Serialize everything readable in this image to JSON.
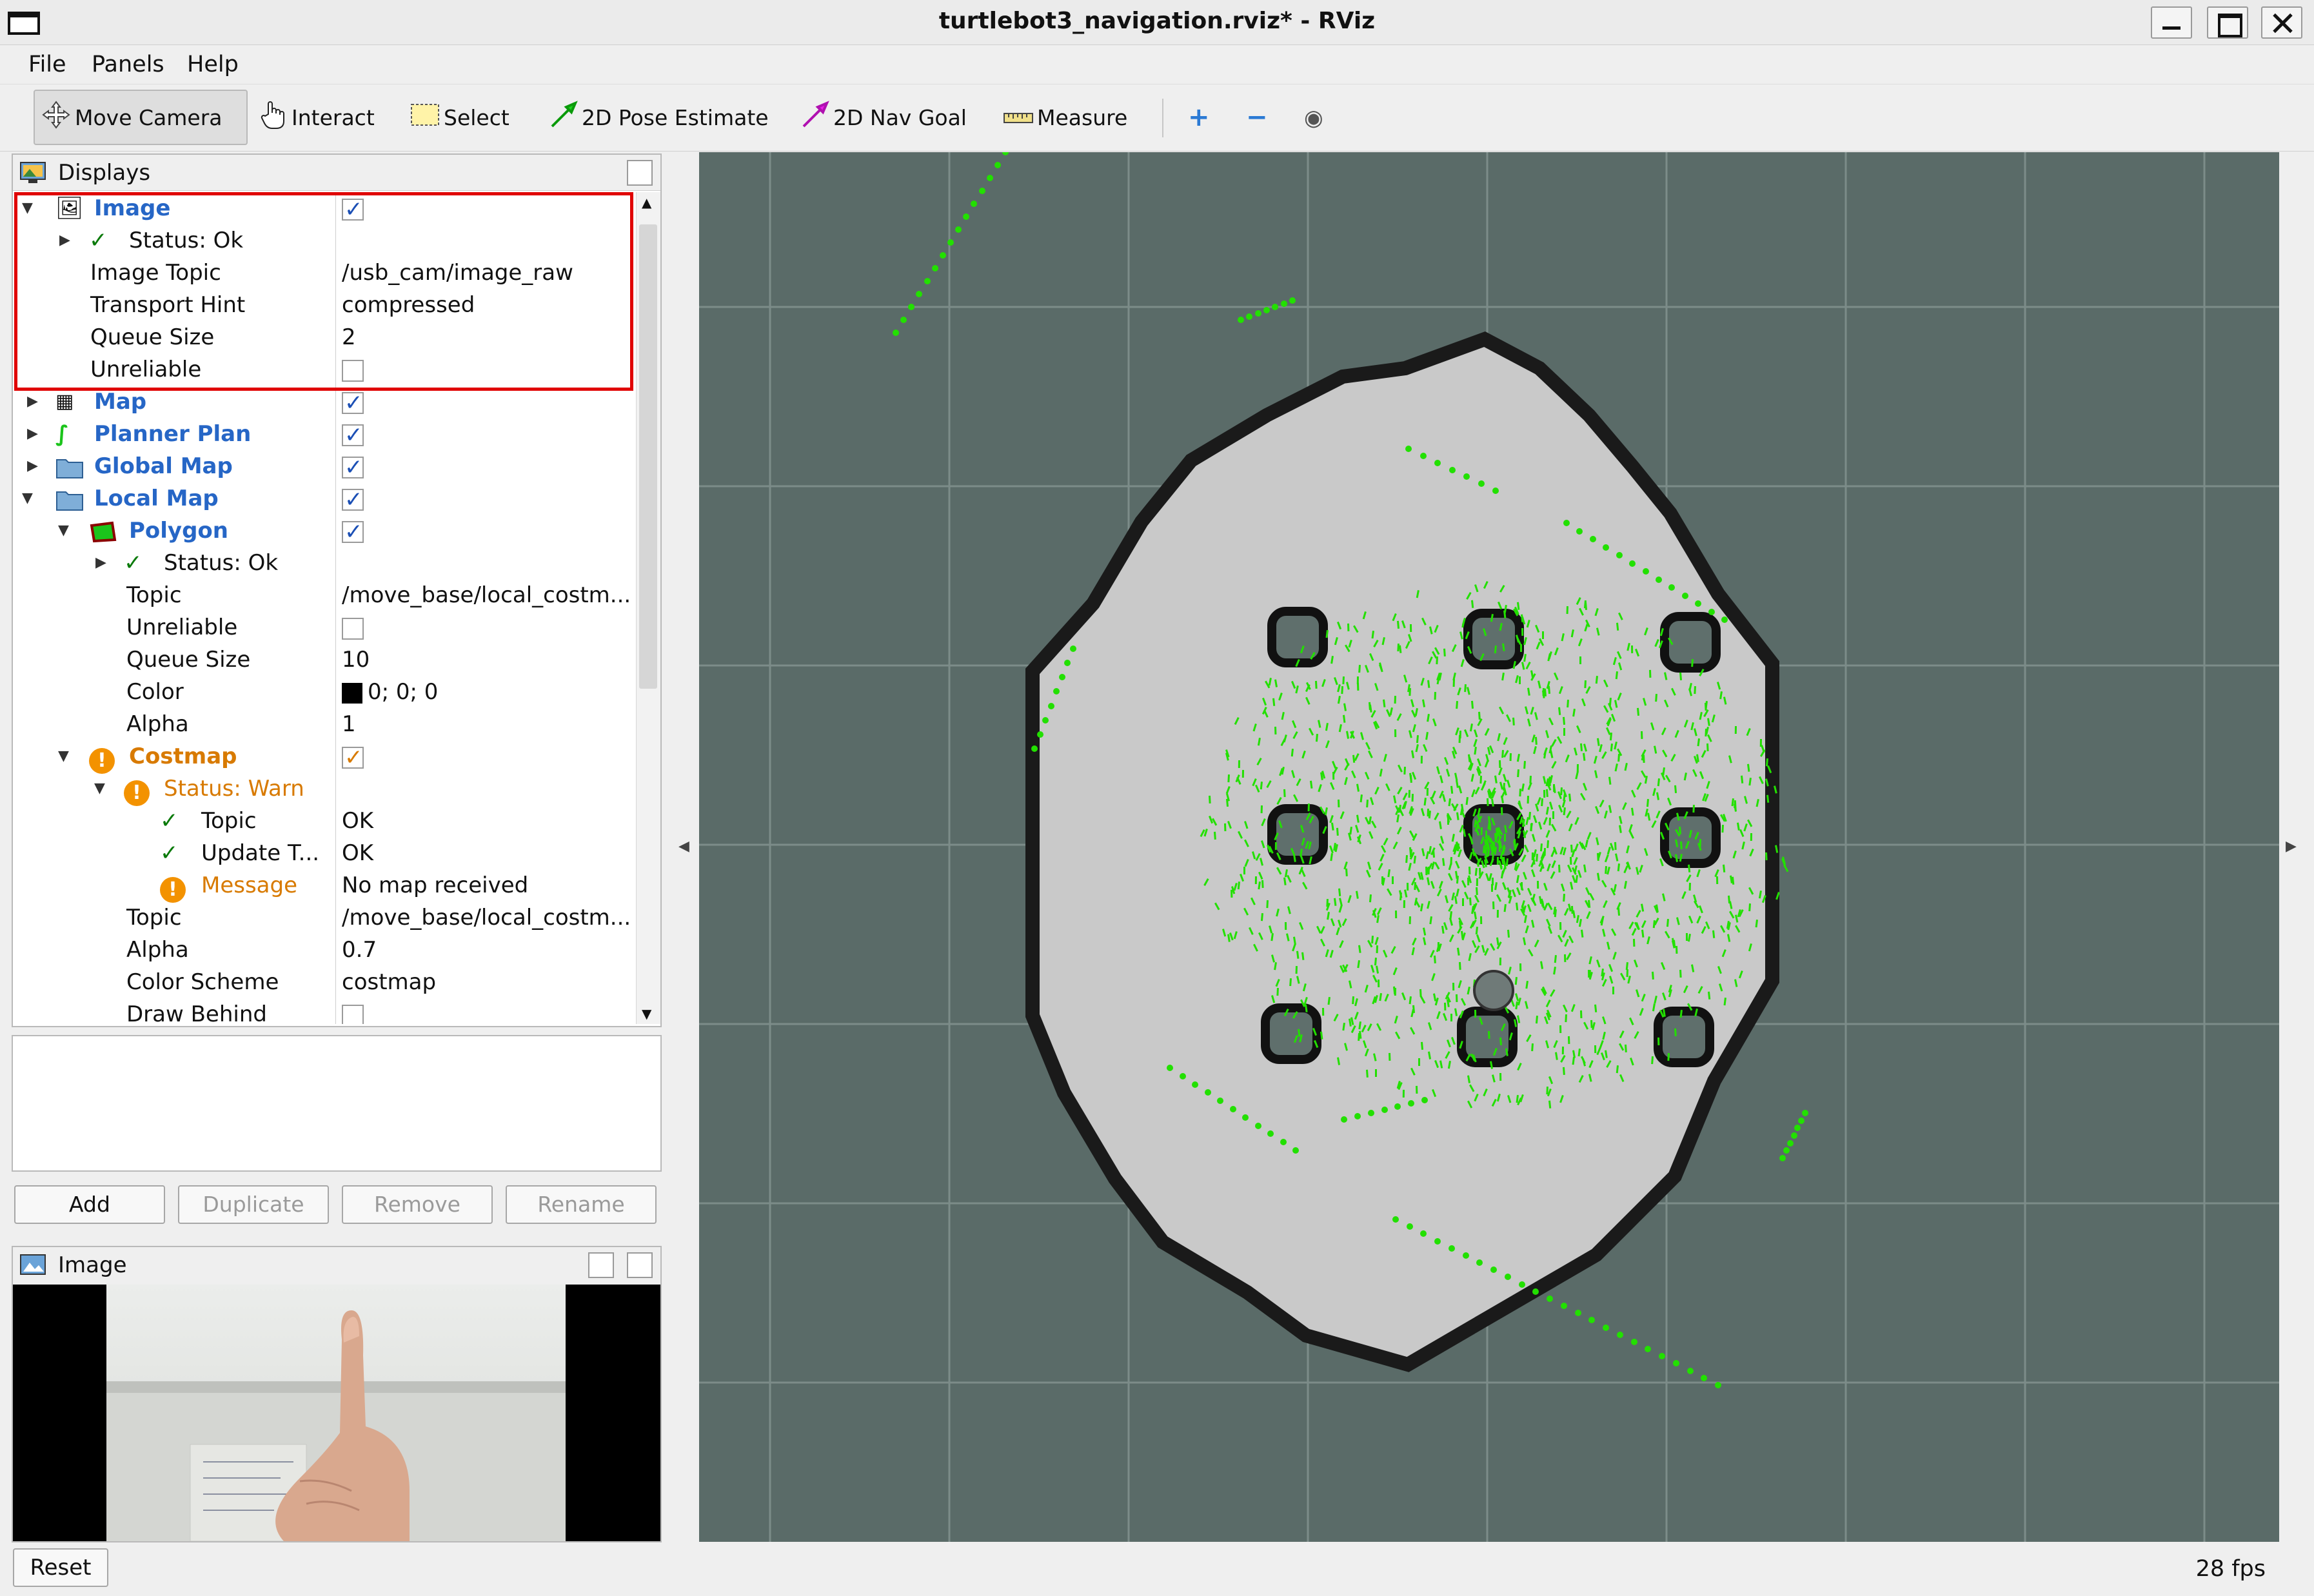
{
  "window": {
    "title": "turtlebot3_navigation.rviz* - RViz"
  },
  "menu": {
    "file": "File",
    "panels": "Panels",
    "help": "Help"
  },
  "toolbar": {
    "move_camera": "Move Camera",
    "interact": "Interact",
    "select": "Select",
    "pose_estimate": "2D Pose Estimate",
    "nav_goal": "2D Nav Goal",
    "measure": "Measure",
    "zoom_in_icon": "plus-icon",
    "zoom_out_icon": "minus-icon",
    "view_icon": "eye-icon"
  },
  "displays": {
    "title": "Displays",
    "image": {
      "label": "Image",
      "status": "Status: Ok",
      "image_topic_label": "Image Topic",
      "image_topic": "/usb_cam/image_raw",
      "transport_hint_label": "Transport Hint",
      "transport_hint": "compressed",
      "queue_size_label": "Queue Size",
      "queue_size": "2",
      "unreliable_label": "Unreliable"
    },
    "map": {
      "label": "Map"
    },
    "planner_plan": {
      "label": "Planner Plan"
    },
    "global_map": {
      "label": "Global Map"
    },
    "local_map": {
      "label": "Local Map"
    },
    "polygon": {
      "label": "Polygon",
      "status": "Status: Ok",
      "topic_label": "Topic",
      "topic": "/move_base/local_costm...",
      "unreliable_label": "Unreliable",
      "queue_size_label": "Queue Size",
      "queue_size": "10",
      "color_label": "Color",
      "color": "0; 0; 0",
      "alpha_label": "Alpha",
      "alpha": "1"
    },
    "costmap": {
      "label": "Costmap",
      "status": "Status: Warn",
      "topic_label": "Topic",
      "topic_status": "OK",
      "update_label": "Update T...",
      "update_status": "OK",
      "message_label": "Message",
      "message": "No map received",
      "topic2_label": "Topic",
      "topic2": "/move_base/local_costm...",
      "alpha_label": "Alpha",
      "alpha": "0.7",
      "color_scheme_label": "Color Scheme",
      "color_scheme": "costmap",
      "draw_behind_label": "Draw Behind"
    }
  },
  "buttons": {
    "add": "Add",
    "duplicate": "Duplicate",
    "remove": "Remove",
    "rename": "Rename"
  },
  "image_panel": {
    "title": "Image"
  },
  "status": {
    "reset": "Reset",
    "fps": "28 fps"
  },
  "colors": {
    "accent": "#2666c6",
    "warn": "#f39200",
    "ok": "#0a7a0a",
    "viewport_bg": "#5a6b68",
    "highlight": "#e00000",
    "particles": "#22e000"
  }
}
